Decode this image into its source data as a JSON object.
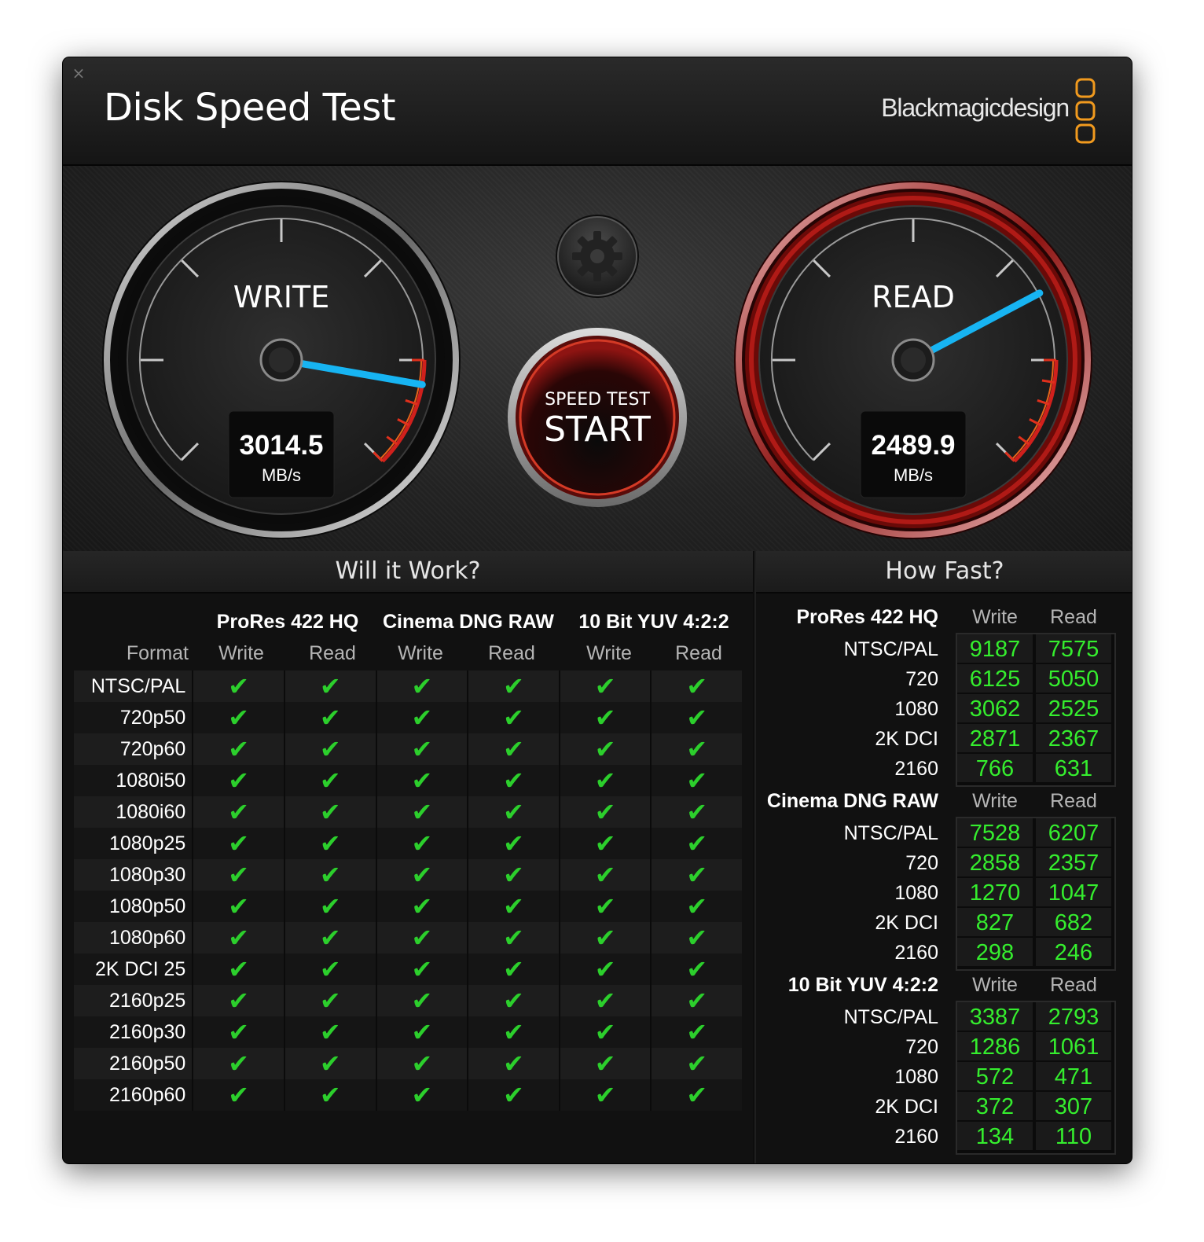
{
  "window": {
    "title": "Disk Speed Test",
    "brand": "Blackmagicdesign",
    "close_glyph": "×"
  },
  "gauges": {
    "write": {
      "label": "WRITE",
      "value": "3014.5",
      "unit": "MB/s",
      "needle_fraction": 0.87
    },
    "read": {
      "label": "READ",
      "value": "2489.9",
      "unit": "MB/s",
      "needle_fraction": 0.73
    }
  },
  "start_button": {
    "top": "SPEED TEST",
    "main": "START"
  },
  "settings_icon": "gear-icon",
  "colors": {
    "accent_red": "#c0201e",
    "needle_blue": "#17b4f2",
    "value_green": "#35ee2e",
    "brand_orange": "#f19a1e"
  },
  "will_it_work": {
    "heading": "Will it Work?",
    "format_header": "Format",
    "codecs": [
      "ProRes 422 HQ",
      "Cinema DNG RAW",
      "10 Bit YUV 4:2:2"
    ],
    "sub_headers": [
      "Write",
      "Read",
      "Write",
      "Read",
      "Write",
      "Read"
    ],
    "check_glyph": "✔",
    "rows": [
      {
        "format": "NTSC/PAL"
      },
      {
        "format": "720p50"
      },
      {
        "format": "720p60"
      },
      {
        "format": "1080i50"
      },
      {
        "format": "1080i60"
      },
      {
        "format": "1080p25"
      },
      {
        "format": "1080p30"
      },
      {
        "format": "1080p50"
      },
      {
        "format": "1080p60"
      },
      {
        "format": "2K DCI 25"
      },
      {
        "format": "2160p25"
      },
      {
        "format": "2160p30"
      },
      {
        "format": "2160p50"
      },
      {
        "format": "2160p60"
      }
    ]
  },
  "how_fast": {
    "heading": "How Fast?",
    "sections": [
      {
        "codec": "ProRes 422 HQ",
        "write_header": "Write",
        "read_header": "Read",
        "rows": [
          {
            "label": "NTSC/PAL",
            "write": "9187",
            "read": "7575"
          },
          {
            "label": "720",
            "write": "6125",
            "read": "5050"
          },
          {
            "label": "1080",
            "write": "3062",
            "read": "2525"
          },
          {
            "label": "2K DCI",
            "write": "2871",
            "read": "2367"
          },
          {
            "label": "2160",
            "write": "766",
            "read": "631"
          }
        ]
      },
      {
        "codec": "Cinema DNG RAW",
        "write_header": "Write",
        "read_header": "Read",
        "rows": [
          {
            "label": "NTSC/PAL",
            "write": "7528",
            "read": "6207"
          },
          {
            "label": "720",
            "write": "2858",
            "read": "2357"
          },
          {
            "label": "1080",
            "write": "1270",
            "read": "1047"
          },
          {
            "label": "2K DCI",
            "write": "827",
            "read": "682"
          },
          {
            "label": "2160",
            "write": "298",
            "read": "246"
          }
        ]
      },
      {
        "codec": "10 Bit YUV 4:2:2",
        "write_header": "Write",
        "read_header": "Read",
        "rows": [
          {
            "label": "NTSC/PAL",
            "write": "3387",
            "read": "2793"
          },
          {
            "label": "720",
            "write": "1286",
            "read": "1061"
          },
          {
            "label": "1080",
            "write": "572",
            "read": "471"
          },
          {
            "label": "2K DCI",
            "write": "372",
            "read": "307"
          },
          {
            "label": "2160",
            "write": "134",
            "read": "110"
          }
        ]
      }
    ]
  }
}
